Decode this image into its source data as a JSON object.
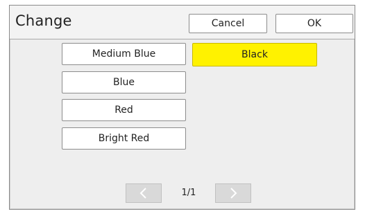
{
  "dialog": {
    "title": "Change",
    "cancel_label": "Cancel",
    "ok_label": "OK"
  },
  "colors": {
    "items": [
      {
        "label": "Medium Blue"
      },
      {
        "label": "Blue"
      },
      {
        "label": "Red"
      },
      {
        "label": "Bright Red"
      }
    ],
    "selected": {
      "label": "Black"
    }
  },
  "pager": {
    "page": "1/1",
    "prev_icon": "chevron-left-icon",
    "next_icon": "chevron-right-icon"
  },
  "theme": {
    "selected_color": "#fff200",
    "dialog_bg": "#eeeeee"
  }
}
